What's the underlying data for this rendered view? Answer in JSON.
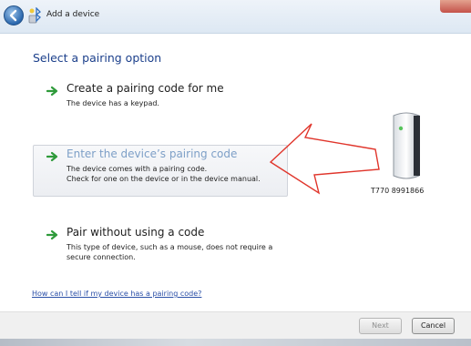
{
  "window": {
    "title": "Add a device"
  },
  "heading": "Select a pairing option",
  "options": [
    {
      "title": "Create a pairing code for me",
      "description": "The device has a keypad."
    },
    {
      "title": "Enter the device’s pairing code",
      "description_line1": "The device comes with a pairing code.",
      "description_line2": "Check for one on the device or in the device manual."
    },
    {
      "title": "Pair without using a code",
      "description_line1": "This type of device, such as a mouse, does not require a",
      "description_line2": "secure connection."
    }
  ],
  "help_link": "How can I tell if my device has a pairing code?",
  "device": {
    "label": "T770 8991866",
    "icon": "device-tower-icon"
  },
  "buttons": {
    "next": "Next",
    "cancel": "Cancel"
  },
  "colors": {
    "heading": "#1b3f8b",
    "link": "#2a4fa7",
    "highlight_arrow": "#e0352b",
    "green_arrow": "#2e9a3a"
  }
}
